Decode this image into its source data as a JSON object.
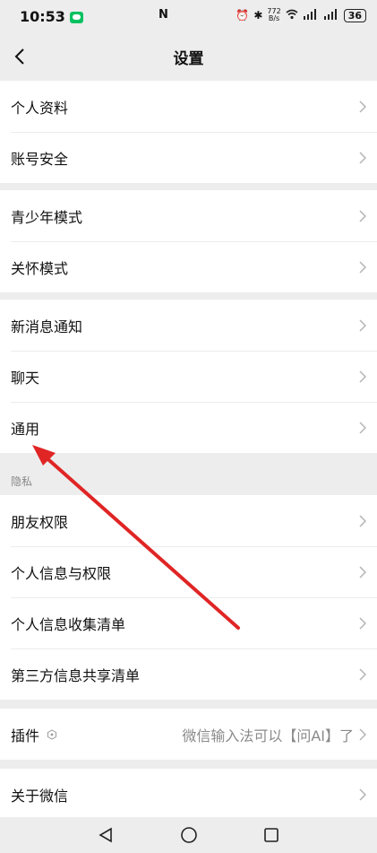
{
  "status": {
    "time": "10:53",
    "nfc": "N",
    "speed": "772\nB/s",
    "battery": "36"
  },
  "header": {
    "title": "设置"
  },
  "groups": {
    "g1": [
      "个人资料",
      "账号安全"
    ],
    "g2": [
      "青少年模式",
      "关怀模式"
    ],
    "g3": [
      "新消息通知",
      "聊天",
      "通用"
    ],
    "privacy_title": "隐私",
    "g4": [
      "朋友权限",
      "个人信息与权限",
      "个人信息收集清单",
      "第三方信息共享清单"
    ],
    "plugin": {
      "label": "插件",
      "value": "微信输入法可以【问AI】了"
    },
    "about": "关于微信"
  },
  "colors": {
    "arrow": "#e02525",
    "chevron": "#b4b4b4"
  },
  "icons": [
    "back-icon",
    "chevron-right-icon",
    "plugin-icon",
    "nav-back-icon",
    "nav-home-icon",
    "nav-recents-icon"
  ]
}
